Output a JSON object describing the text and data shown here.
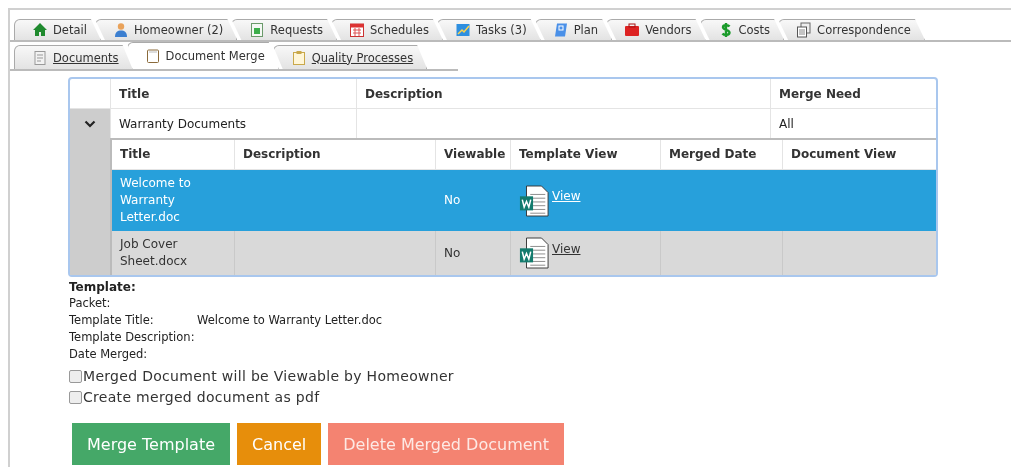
{
  "tabs": [
    {
      "label": "Detail",
      "selected": false
    },
    {
      "label": "Homeowner (2)",
      "selected": false
    },
    {
      "label": "Requests",
      "selected": false
    },
    {
      "label": "Schedules",
      "selected": false
    },
    {
      "label": "Tasks (3)",
      "selected": false
    },
    {
      "label": "Plan",
      "selected": false
    },
    {
      "label": "Vendors",
      "selected": false
    },
    {
      "label": "Costs",
      "selected": false
    },
    {
      "label": "Correspondence",
      "selected": false
    }
  ],
  "subtabs": [
    {
      "label": "Documents",
      "selected": false
    },
    {
      "label": "Document Merge",
      "selected": true
    },
    {
      "label": "Quality Processes",
      "selected": false
    }
  ],
  "table": {
    "columns": [
      "Title",
      "Description",
      "Merge Need"
    ],
    "groups": [
      {
        "title": "Warranty Documents",
        "merge_need": "All",
        "expanded": true,
        "columns": [
          "Title",
          "Description",
          "Viewable",
          "Template View",
          "Merged Date",
          "Document View"
        ],
        "rows": [
          {
            "title": "Welcome to Warranty Letter.doc",
            "viewable": "No",
            "template_view": "View",
            "selected": true
          },
          {
            "title": "Job Cover Sheet.docx",
            "viewable": "No",
            "template_view": "View",
            "selected": false
          }
        ]
      }
    ]
  },
  "details": {
    "heading": "Template:",
    "fields": [
      {
        "label": "Packet:"
      },
      {
        "label": "Template Title:",
        "value": "Welcome to Warranty Letter.doc"
      },
      {
        "label": "Template Description:"
      },
      {
        "label": "Date Merged:"
      }
    ]
  },
  "options": [
    {
      "label": "Merged Document will be Viewable by Homeowner",
      "checked": false
    },
    {
      "label": "Create merged document as pdf",
      "checked": false
    }
  ],
  "buttons": [
    {
      "label": "Merge Template",
      "kind": "primary"
    },
    {
      "label": "Cancel",
      "kind": "warning"
    },
    {
      "label": "Delete Merged Document",
      "kind": "danger"
    }
  ]
}
